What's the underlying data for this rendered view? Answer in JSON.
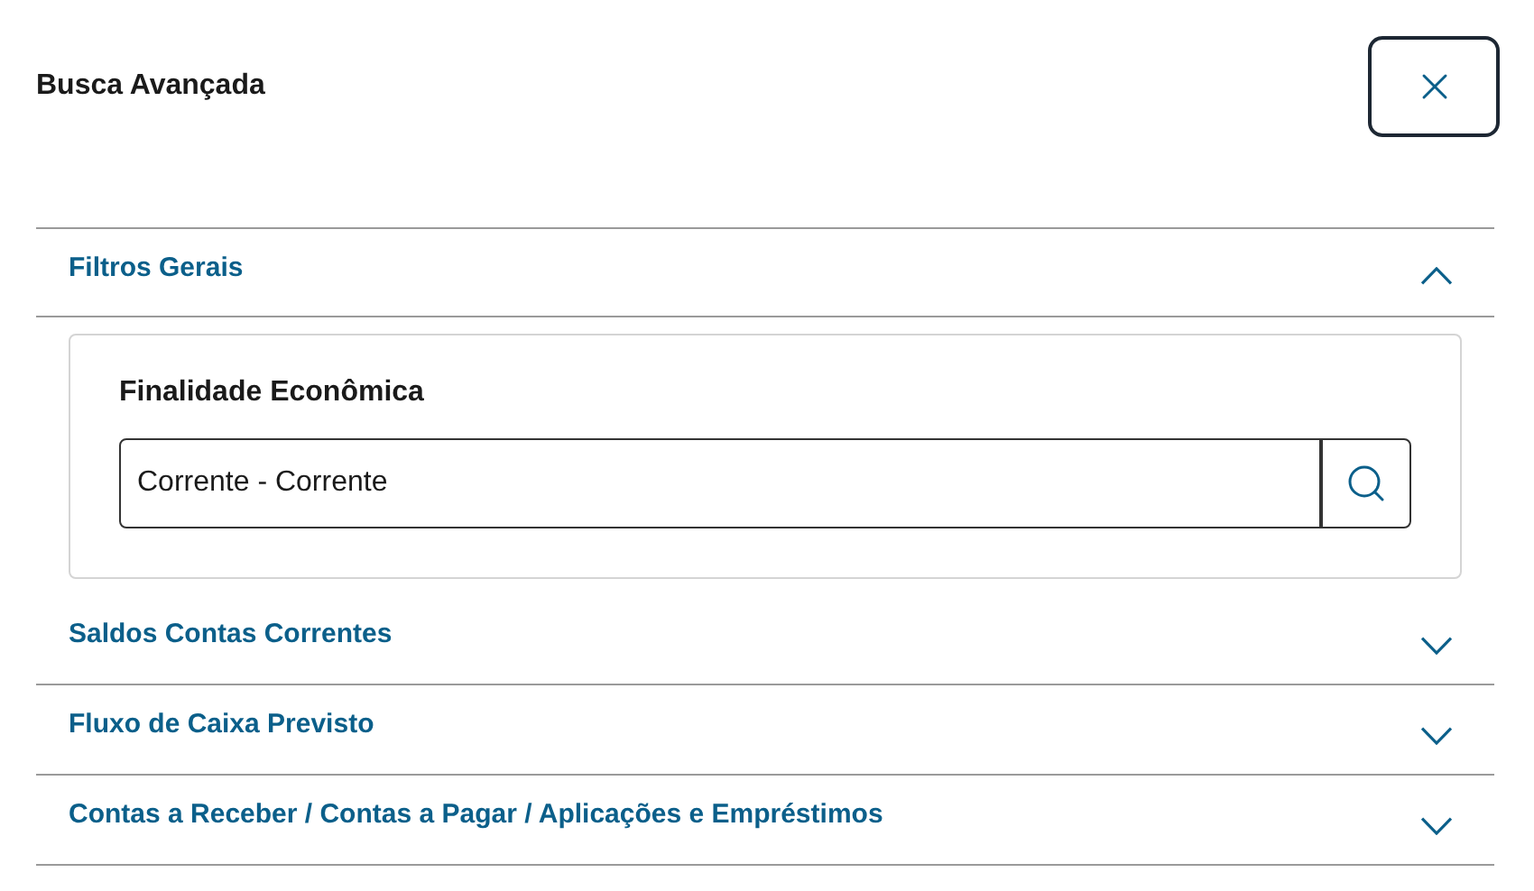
{
  "title": "Busca Avançada",
  "sections": [
    {
      "label": "Filtros Gerais",
      "expanded": true,
      "field": {
        "label": "Finalidade Econômica",
        "value": "Corrente - Corrente"
      }
    },
    {
      "label": "Saldos Contas Correntes",
      "expanded": false
    },
    {
      "label": "Fluxo de Caixa Previsto",
      "expanded": false
    },
    {
      "label": "Contas a Receber / Contas a Pagar / Aplicações e Empréstimos",
      "expanded": false
    }
  ]
}
